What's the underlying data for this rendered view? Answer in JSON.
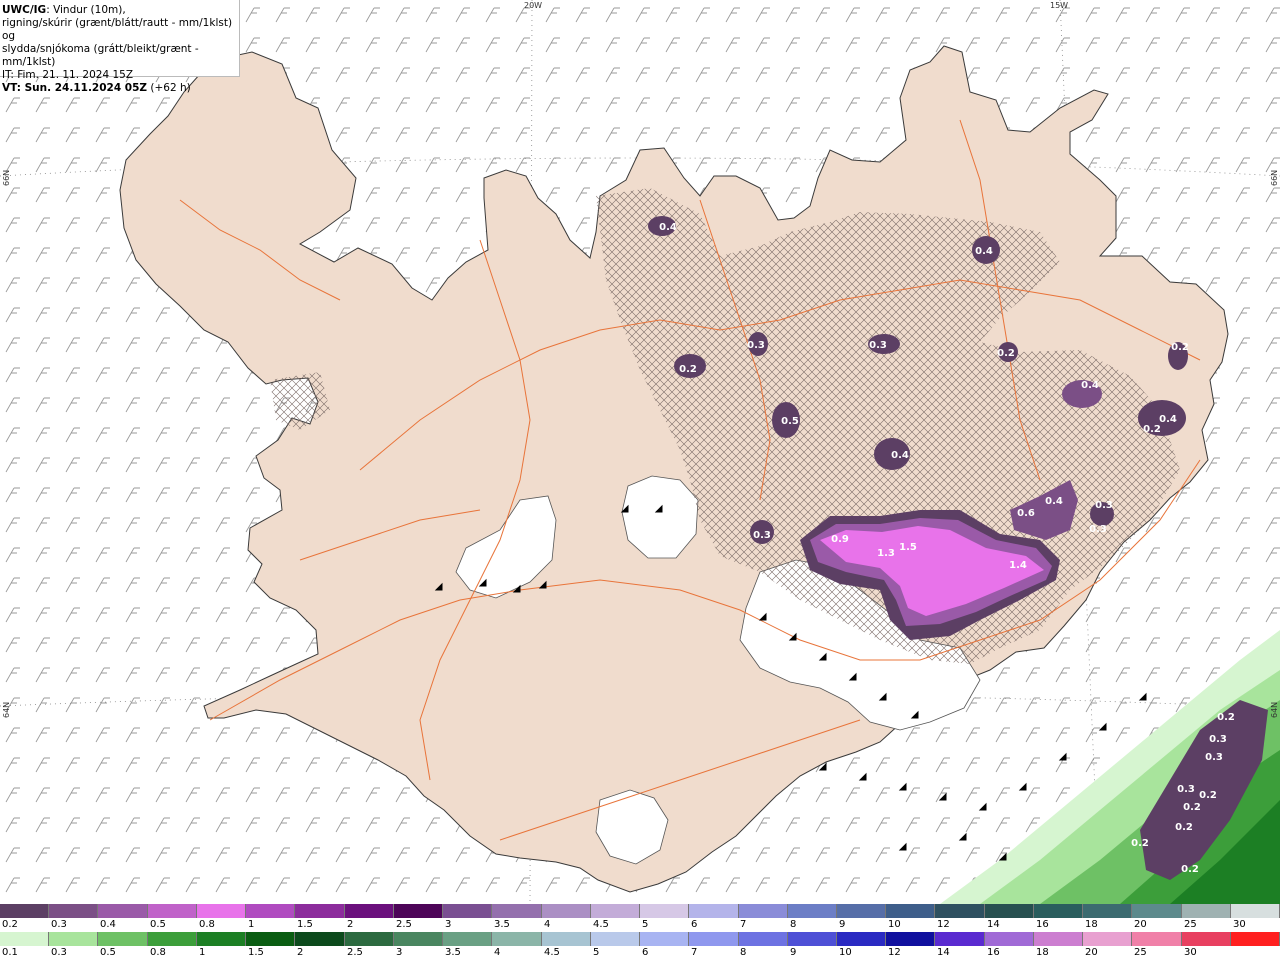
{
  "header": {
    "title_bold": "UWC/IG",
    "title_rest": ": Vindur (10m),",
    "line2": "rigning/skúrir (grænt/blátt/rautt - mm/1klst) og",
    "line3": "slydda/snjókoma (grátt/bleikt/grænt - mm/1klst)",
    "line4": "IT: Fim. 21. 11. 2024 15Z",
    "line5_bold": "VT: Sun. 24.11.2024 05Z",
    "line5_rest": " (+62 h)"
  },
  "graticule": {
    "lon_20w": "20W",
    "lon_15w": "15W",
    "lat_66n_left": "66N",
    "lat_66n_right": "66N",
    "lat_64n_left": "64N",
    "lat_64n_right": "64N"
  },
  "snow_labels": [
    "0.4",
    "0.4",
    "0.2",
    "0.3",
    "0.3",
    "0.2",
    "0.2",
    "0.5",
    "0.4",
    "0.4",
    "0.2",
    "0.4",
    "0.6",
    "0.4",
    "0.3",
    "0.3",
    "0.3",
    "0.9",
    "1.3",
    "1.5",
    "1.4"
  ],
  "rain_labels": [
    "0.2",
    "0.3",
    "0.3",
    "0.3",
    "0.2",
    "0.2",
    "0.2",
    "0.2",
    "0.2"
  ],
  "snow_scale": {
    "labels": [
      "0.2",
      "0.3",
      "0.4",
      "0.5",
      "0.8",
      "1",
      "1.5",
      "2",
      "2.5",
      "3",
      "3.5",
      "4",
      "4.5",
      "5",
      "6",
      "7",
      "8",
      "9",
      "10",
      "12",
      "14",
      "16",
      "18",
      "20",
      "25",
      "30"
    ],
    "colors": [
      "#5c3f64",
      "#7b4f86",
      "#9a5aa8",
      "#c062c9",
      "#e873ea",
      "#b04bc0",
      "#8c2c9c",
      "#6b107d",
      "#4d0558",
      "#7a4f92",
      "#9470ad",
      "#ab8fc4",
      "#c3acd8",
      "#d6c8e6",
      "#b4b4ea",
      "#8a8cd8",
      "#6c7ec6",
      "#566ea8",
      "#3e5e8a",
      "#2e5060",
      "#275050",
      "#2a5e5e",
      "#3c6b70",
      "#5d8a8c",
      "#9fb2b2",
      "#d7dfdf"
    ]
  },
  "rain_scale": {
    "labels": [
      "0.1",
      "0.3",
      "0.5",
      "0.8",
      "1",
      "1.5",
      "2",
      "2.5",
      "3",
      "3.5",
      "4",
      "4.5",
      "5",
      "6",
      "7",
      "8",
      "9",
      "10",
      "12",
      "14",
      "16",
      "18",
      "20",
      "25",
      "30"
    ],
    "colors": [
      "#d6f5d0",
      "#a8e49c",
      "#6ec165",
      "#3c9e3a",
      "#1c7f24",
      "#0a5d12",
      "#0c4a1c",
      "#2c6a40",
      "#4a8660",
      "#6aa084",
      "#8bb5a8",
      "#a7c4d2",
      "#b9c9ea",
      "#a8b4f2",
      "#8f98ee",
      "#6d72e2",
      "#4e50d6",
      "#2a2ac2",
      "#10109e",
      "#5a2ad0",
      "#a06ad6",
      "#cc7ed0",
      "#e8a0d0",
      "#f080a8",
      "#e84060",
      "#ff2020"
    ]
  }
}
